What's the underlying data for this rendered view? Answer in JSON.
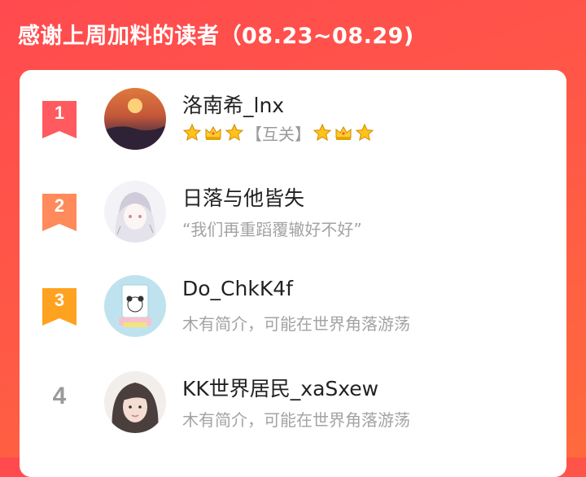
{
  "header": {
    "title": "感谢上周加料的读者（08.23~08.29)"
  },
  "readers": [
    {
      "rank": "1",
      "name": "洛南希_lnx",
      "bio_text": "【互关】",
      "bio_icons_left": [
        "star-icon",
        "crown-icon",
        "star-icon"
      ],
      "bio_icons_right": [
        "star-icon",
        "crown-icon",
        "star-icon"
      ]
    },
    {
      "rank": "2",
      "name": "日落与他皆失",
      "bio": "“我们再重蹈覆辙好不好”"
    },
    {
      "rank": "3",
      "name": "Do_ChkK4f",
      "bio": "木有简介，可能在世界角落游荡"
    },
    {
      "rank": "4",
      "name": "KK世界居民_xaSxew",
      "bio": "木有简介，可能在世界角落游荡"
    }
  ],
  "colors": {
    "header_bg": "#ff4a4f",
    "rank1": "#ff5a5f",
    "rank2": "#ff8a5b",
    "rank3": "#ffa21f",
    "rank_plain": "#9a9a9a",
    "name": "#222222",
    "bio": "#a3a3a3"
  }
}
